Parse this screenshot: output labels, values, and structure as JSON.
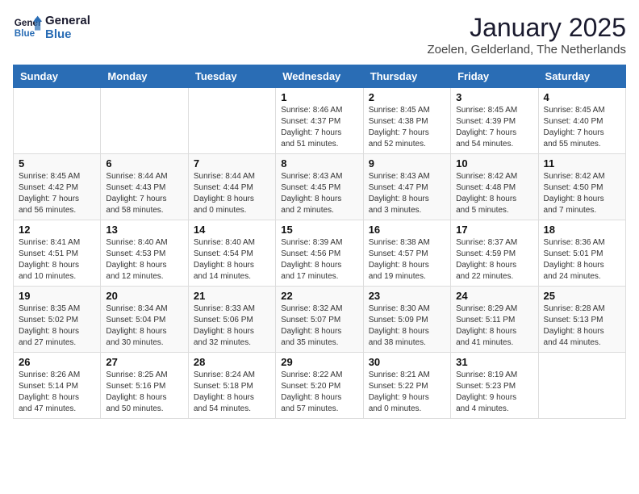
{
  "header": {
    "logo_line1": "General",
    "logo_line2": "Blue",
    "title": "January 2025",
    "subtitle": "Zoelen, Gelderland, The Netherlands"
  },
  "weekdays": [
    "Sunday",
    "Monday",
    "Tuesday",
    "Wednesday",
    "Thursday",
    "Friday",
    "Saturday"
  ],
  "weeks": [
    [
      {
        "day": "",
        "info": ""
      },
      {
        "day": "",
        "info": ""
      },
      {
        "day": "",
        "info": ""
      },
      {
        "day": "1",
        "info": "Sunrise: 8:46 AM\nSunset: 4:37 PM\nDaylight: 7 hours\nand 51 minutes."
      },
      {
        "day": "2",
        "info": "Sunrise: 8:45 AM\nSunset: 4:38 PM\nDaylight: 7 hours\nand 52 minutes."
      },
      {
        "day": "3",
        "info": "Sunrise: 8:45 AM\nSunset: 4:39 PM\nDaylight: 7 hours\nand 54 minutes."
      },
      {
        "day": "4",
        "info": "Sunrise: 8:45 AM\nSunset: 4:40 PM\nDaylight: 7 hours\nand 55 minutes."
      }
    ],
    [
      {
        "day": "5",
        "info": "Sunrise: 8:45 AM\nSunset: 4:42 PM\nDaylight: 7 hours\nand 56 minutes."
      },
      {
        "day": "6",
        "info": "Sunrise: 8:44 AM\nSunset: 4:43 PM\nDaylight: 7 hours\nand 58 minutes."
      },
      {
        "day": "7",
        "info": "Sunrise: 8:44 AM\nSunset: 4:44 PM\nDaylight: 8 hours\nand 0 minutes."
      },
      {
        "day": "8",
        "info": "Sunrise: 8:43 AM\nSunset: 4:45 PM\nDaylight: 8 hours\nand 2 minutes."
      },
      {
        "day": "9",
        "info": "Sunrise: 8:43 AM\nSunset: 4:47 PM\nDaylight: 8 hours\nand 3 minutes."
      },
      {
        "day": "10",
        "info": "Sunrise: 8:42 AM\nSunset: 4:48 PM\nDaylight: 8 hours\nand 5 minutes."
      },
      {
        "day": "11",
        "info": "Sunrise: 8:42 AM\nSunset: 4:50 PM\nDaylight: 8 hours\nand 7 minutes."
      }
    ],
    [
      {
        "day": "12",
        "info": "Sunrise: 8:41 AM\nSunset: 4:51 PM\nDaylight: 8 hours\nand 10 minutes."
      },
      {
        "day": "13",
        "info": "Sunrise: 8:40 AM\nSunset: 4:53 PM\nDaylight: 8 hours\nand 12 minutes."
      },
      {
        "day": "14",
        "info": "Sunrise: 8:40 AM\nSunset: 4:54 PM\nDaylight: 8 hours\nand 14 minutes."
      },
      {
        "day": "15",
        "info": "Sunrise: 8:39 AM\nSunset: 4:56 PM\nDaylight: 8 hours\nand 17 minutes."
      },
      {
        "day": "16",
        "info": "Sunrise: 8:38 AM\nSunset: 4:57 PM\nDaylight: 8 hours\nand 19 minutes."
      },
      {
        "day": "17",
        "info": "Sunrise: 8:37 AM\nSunset: 4:59 PM\nDaylight: 8 hours\nand 22 minutes."
      },
      {
        "day": "18",
        "info": "Sunrise: 8:36 AM\nSunset: 5:01 PM\nDaylight: 8 hours\nand 24 minutes."
      }
    ],
    [
      {
        "day": "19",
        "info": "Sunrise: 8:35 AM\nSunset: 5:02 PM\nDaylight: 8 hours\nand 27 minutes."
      },
      {
        "day": "20",
        "info": "Sunrise: 8:34 AM\nSunset: 5:04 PM\nDaylight: 8 hours\nand 30 minutes."
      },
      {
        "day": "21",
        "info": "Sunrise: 8:33 AM\nSunset: 5:06 PM\nDaylight: 8 hours\nand 32 minutes."
      },
      {
        "day": "22",
        "info": "Sunrise: 8:32 AM\nSunset: 5:07 PM\nDaylight: 8 hours\nand 35 minutes."
      },
      {
        "day": "23",
        "info": "Sunrise: 8:30 AM\nSunset: 5:09 PM\nDaylight: 8 hours\nand 38 minutes."
      },
      {
        "day": "24",
        "info": "Sunrise: 8:29 AM\nSunset: 5:11 PM\nDaylight: 8 hours\nand 41 minutes."
      },
      {
        "day": "25",
        "info": "Sunrise: 8:28 AM\nSunset: 5:13 PM\nDaylight: 8 hours\nand 44 minutes."
      }
    ],
    [
      {
        "day": "26",
        "info": "Sunrise: 8:26 AM\nSunset: 5:14 PM\nDaylight: 8 hours\nand 47 minutes."
      },
      {
        "day": "27",
        "info": "Sunrise: 8:25 AM\nSunset: 5:16 PM\nDaylight: 8 hours\nand 50 minutes."
      },
      {
        "day": "28",
        "info": "Sunrise: 8:24 AM\nSunset: 5:18 PM\nDaylight: 8 hours\nand 54 minutes."
      },
      {
        "day": "29",
        "info": "Sunrise: 8:22 AM\nSunset: 5:20 PM\nDaylight: 8 hours\nand 57 minutes."
      },
      {
        "day": "30",
        "info": "Sunrise: 8:21 AM\nSunset: 5:22 PM\nDaylight: 9 hours\nand 0 minutes."
      },
      {
        "day": "31",
        "info": "Sunrise: 8:19 AM\nSunset: 5:23 PM\nDaylight: 9 hours\nand 4 minutes."
      },
      {
        "day": "",
        "info": ""
      }
    ]
  ]
}
